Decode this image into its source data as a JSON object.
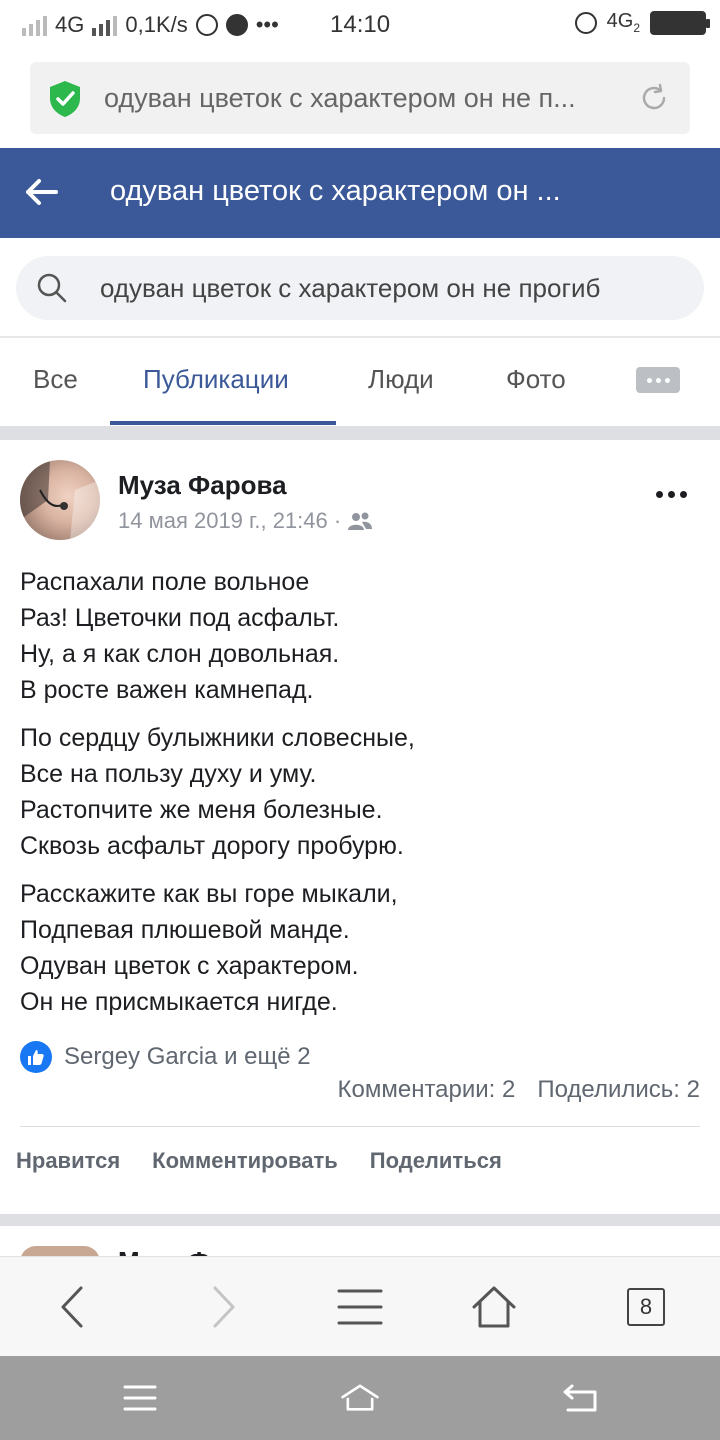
{
  "status_bar": {
    "network": "4G",
    "speed": "0,1K/s",
    "time": "14:10",
    "network_right": "4G",
    "network_right_sub": "2"
  },
  "browser": {
    "url": "одуван цветок с характером он не п...",
    "tab_count": "8"
  },
  "header": {
    "title": "одуван цветок с характером он ..."
  },
  "search": {
    "query": "одуван цветок с характером он не прогиб"
  },
  "tabs": [
    {
      "label": "Все"
    },
    {
      "label": "Публикации"
    },
    {
      "label": "Люди"
    },
    {
      "label": "Фото"
    }
  ],
  "post": {
    "author": "Муза Фарова",
    "date": "14 мая 2019 г., 21:46 ·",
    "stanzas": [
      [
        "Распахали поле вольное",
        "Раз! Цветочки под асфальт.",
        "Ну, а я как слон довольная.",
        "В росте важен камнепад."
      ],
      [
        "По сердцу булыжники словесные,",
        "Все на пользу духу и уму.",
        "Растопчите же меня болезные.",
        "Сквозь асфальт дорогу пробурю."
      ],
      [
        "Расскажите как вы горе мыкали,",
        "Подпевая плюшевой манде.",
        "Одуван цветок с характером.",
        "Он не присмыкается нигде."
      ]
    ],
    "likes": "Sergey Garcia и ещё 2",
    "comments": "Комментарии: 2",
    "shares": "Поделились: 2",
    "actions": {
      "like": "Нравится",
      "comment": "Комментировать",
      "share": "Поделиться"
    }
  },
  "next_post": {
    "author_line": "Муза Фарова поделилась"
  },
  "colors": {
    "brand": "#3b5998",
    "like_blue": "#1877f2"
  }
}
